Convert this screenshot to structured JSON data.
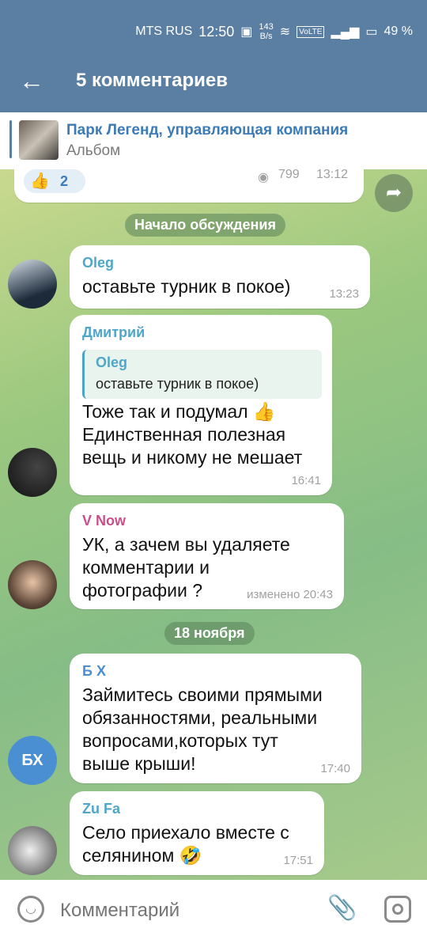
{
  "status": {
    "carrier": "MTS RUS",
    "time": "12:50",
    "speed": "143\nB/s",
    "volte": "VoLTE",
    "battery": "49 %"
  },
  "header": {
    "title": "5 комментариев"
  },
  "pinned": {
    "title": "Парк Легенд, управляющая компания",
    "subtitle": "Альбом"
  },
  "post": {
    "reactions_count": "2",
    "views": "799",
    "time": "13:12"
  },
  "dividers": {
    "start": "Начало обсуждения",
    "date": "18 ноября"
  },
  "messages": [
    {
      "author": "Oleg",
      "author_color": "#4ea6c9",
      "text": "оставьте турник в покое)",
      "time": "13:23"
    },
    {
      "author": "Дмитрий",
      "author_color": "#4ea6c9",
      "reply_author": "Oleg",
      "reply_text": "оставьте турник в покое)",
      "text": "Тоже так и подумал 👍\nЕдинственная полезная\nвещь и никому не мешает",
      "time": "16:41"
    },
    {
      "author": "V Now",
      "author_color": "#c94e8a",
      "text": "УК, а зачем вы удаляете\nкомментарии и\nфотографии ?",
      "time": "изменено 20:43"
    },
    {
      "author": "Б Х",
      "author_color": "#4a8fd1",
      "avatar_initials": "БХ",
      "text": "Займитесь своими прямыми\nобязанностями, реальными\nвопросами,которых тут\nвыше крыши!",
      "time": "17:40"
    },
    {
      "author": "Zu Fa",
      "author_color": "#4ea6c9",
      "text": "Село приехало вместе с\nселянином 🤣",
      "time": "17:51"
    }
  ],
  "composer": {
    "placeholder": "Комментарий"
  },
  "icons": {
    "back": "arrow-left-icon",
    "emoji": "emoji-icon",
    "attach": "paperclip-icon",
    "camera": "camera-icon",
    "share": "share-icon"
  }
}
